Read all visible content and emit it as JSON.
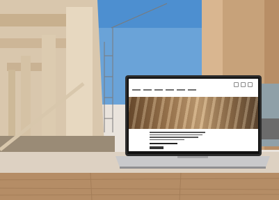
{
  "scene": {
    "laptop_screen": {
      "logo_text": "",
      "hero_title": "",
      "colors": {
        "accent": "#1a5a9a",
        "wood": "#c9a57a"
      }
    }
  }
}
